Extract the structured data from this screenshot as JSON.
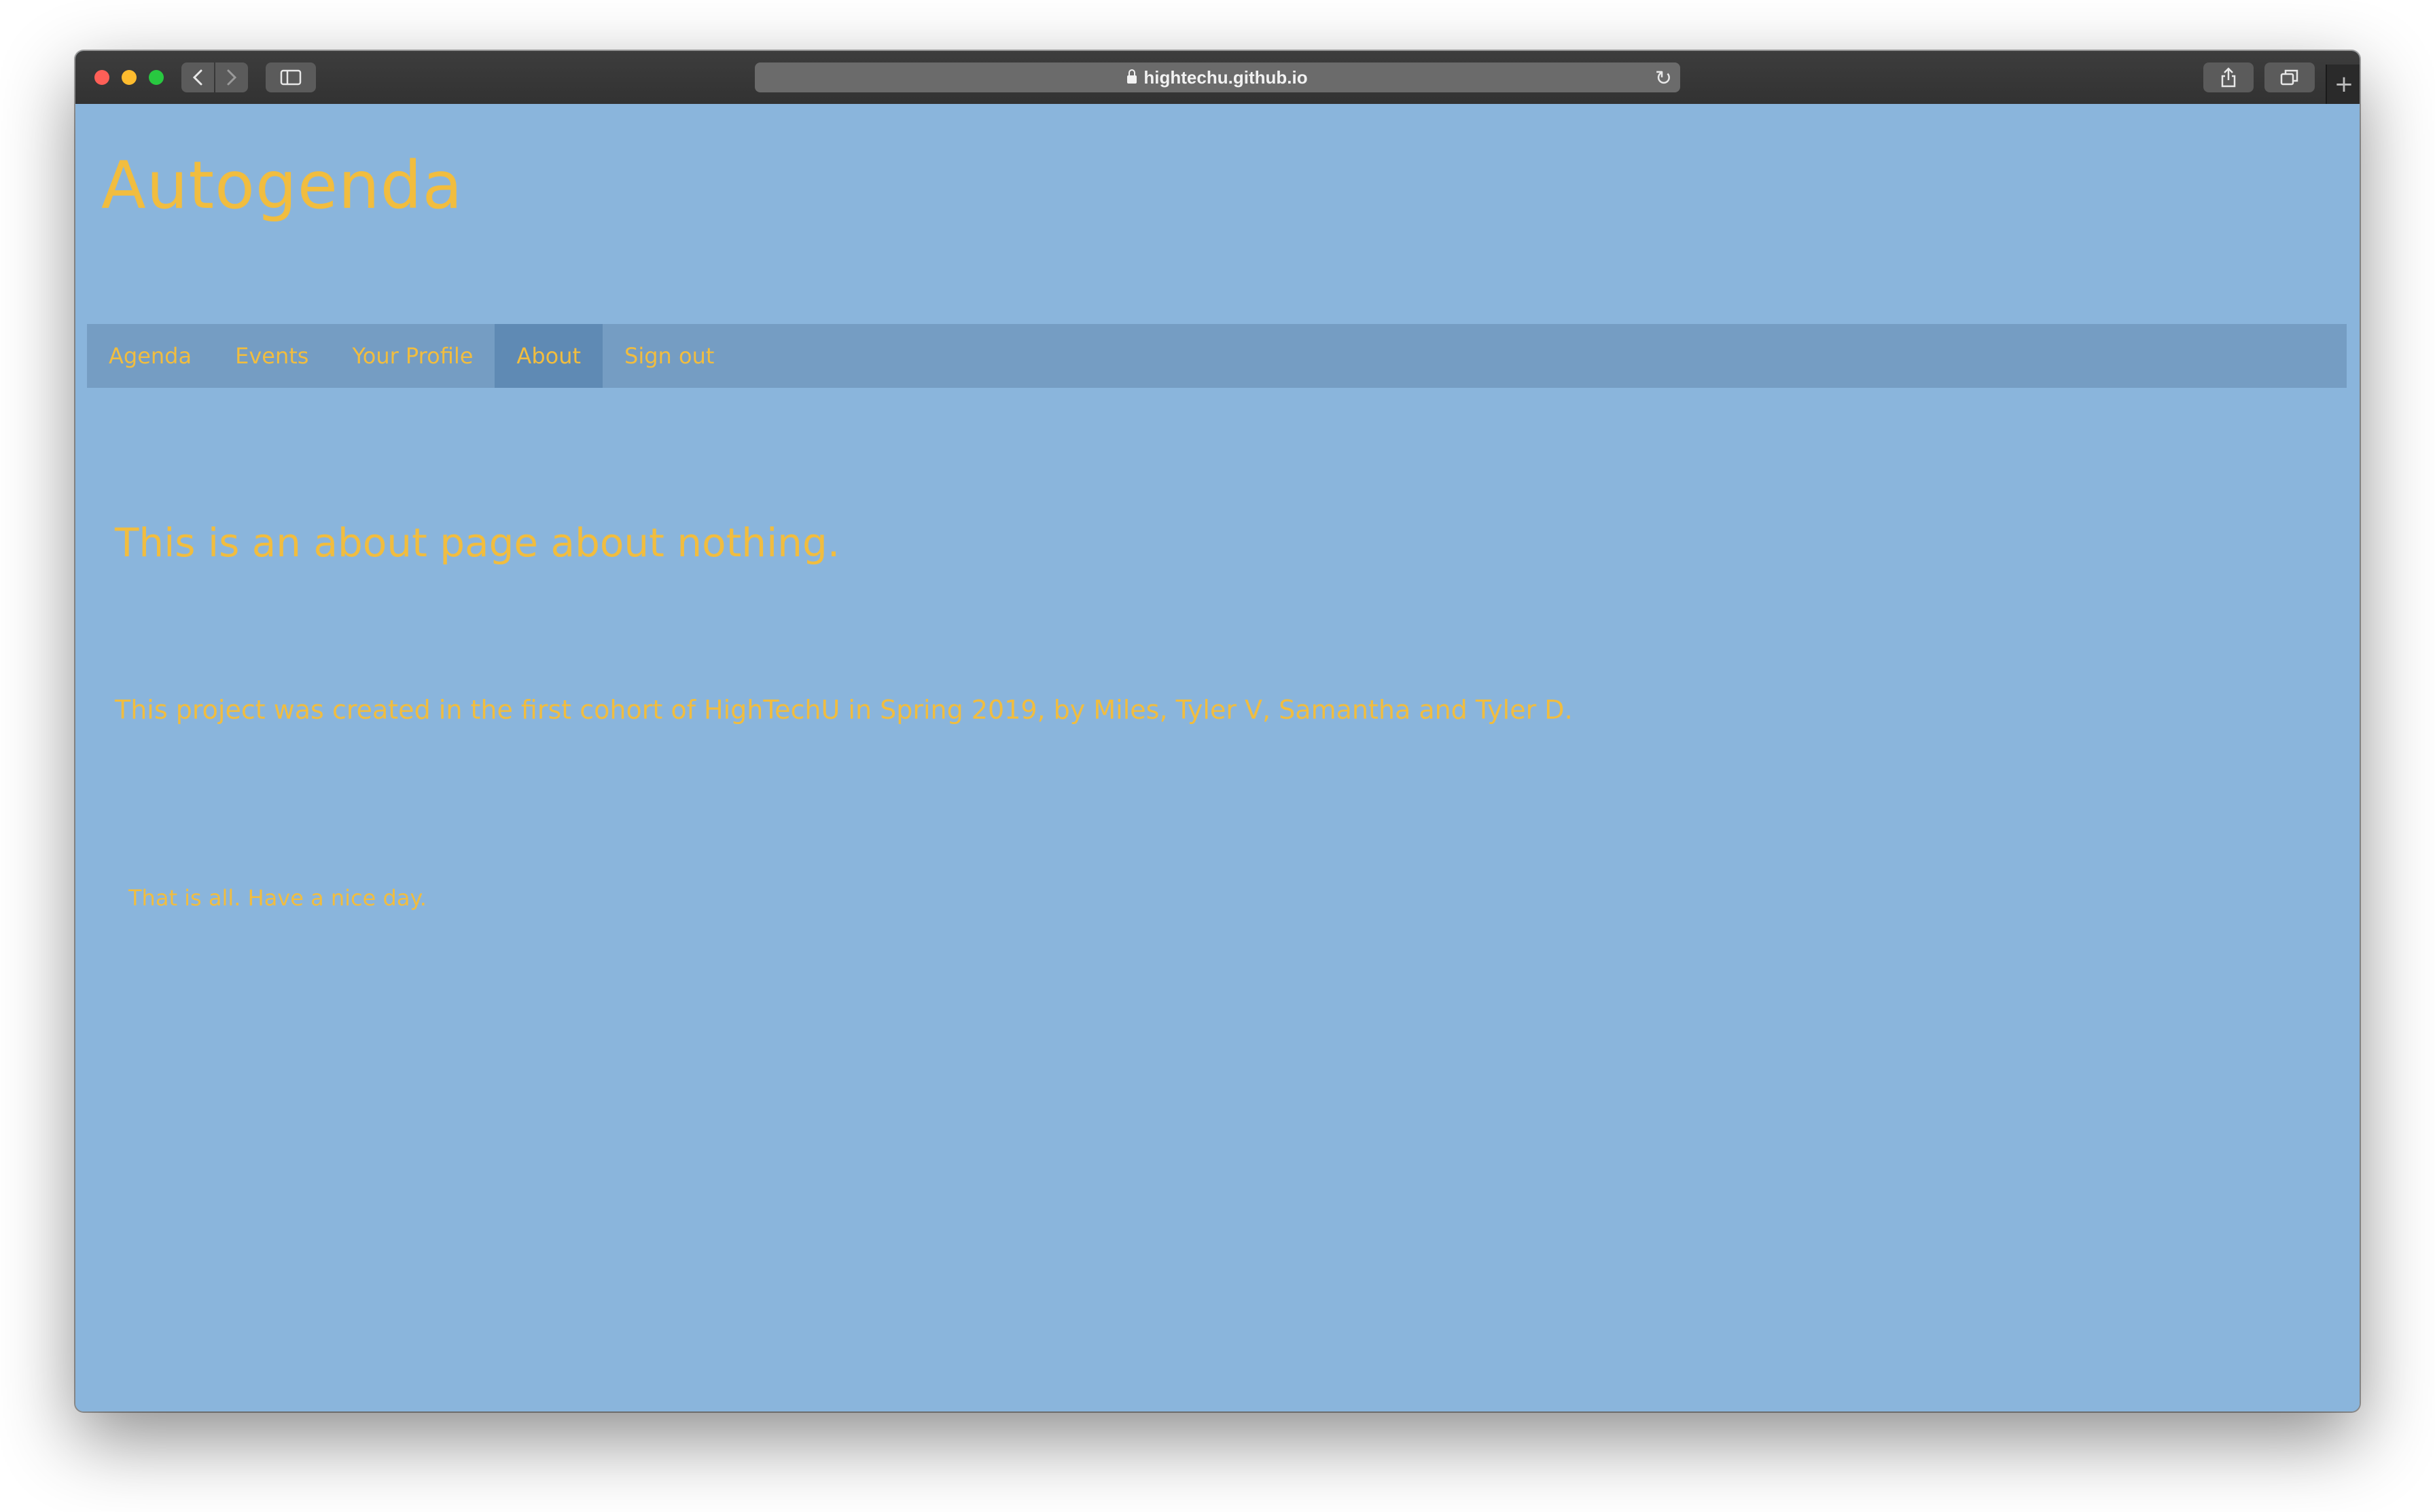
{
  "browser": {
    "url": "hightechu.github.io",
    "colors": {
      "chrome": "#3a3a3a",
      "address_bar": "#6b6b6b",
      "close": "#fe5f57",
      "minimize": "#febc2e",
      "maximize": "#28c840"
    },
    "icons": {
      "back": "chevron-left-icon",
      "forward": "chevron-right-icon",
      "sidebar": "sidebar-icon",
      "lock": "lock-icon",
      "reload": "reload-icon",
      "share": "share-icon",
      "tabs": "tabs-overview-icon",
      "new_tab": "plus-icon"
    },
    "new_tab_glyph": "+"
  },
  "site": {
    "title": "Autogenda",
    "colors": {
      "background": "#8ab5dc",
      "navbar": "#759dc3",
      "nav_active": "#5f8ab4",
      "text": "#f1bd3f"
    }
  },
  "nav": {
    "items": [
      {
        "label": "Agenda"
      },
      {
        "label": "Events"
      },
      {
        "label": "Your Profile"
      },
      {
        "label": "About"
      },
      {
        "label": "Sign out"
      }
    ],
    "active": "About"
  },
  "content": {
    "heading": "This is an about page about nothing.",
    "paragraph": "This project was created in the first cohort of HighTechU in Spring 2019, by Miles, Tyler V, Samantha and Tyler D.",
    "closing": "That is all. Have a nice day."
  }
}
